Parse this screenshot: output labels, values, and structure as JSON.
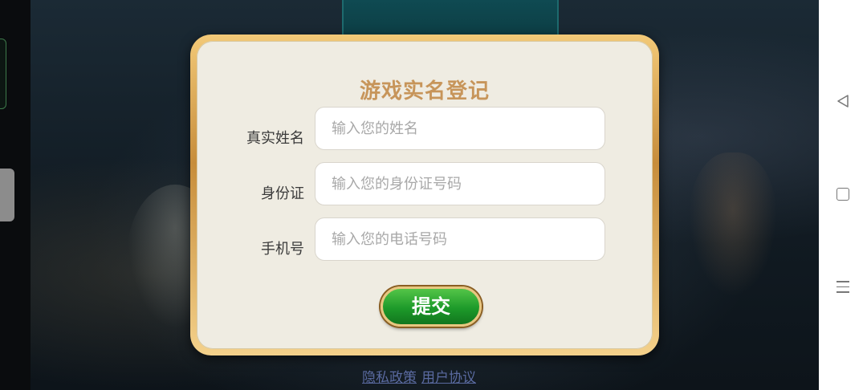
{
  "form": {
    "title": "游戏实名登记",
    "fields": [
      {
        "label": "真实姓名",
        "placeholder": "输入您的姓名"
      },
      {
        "label": "身份证",
        "placeholder": "输入您的身份证号码"
      },
      {
        "label": "手机号",
        "placeholder": "输入您的电话号码"
      }
    ],
    "submit_label": "提交"
  },
  "footer": {
    "privacy_label": "隐私政策",
    "agreement_label": "用户协议"
  },
  "system_nav": {
    "icons": [
      "back-triangle-icon",
      "home-square-icon",
      "menu-lines-icon"
    ]
  },
  "colors": {
    "title": "#c7955a",
    "submit_green": "#1d9a2a",
    "modal_border_gold": "#e2b566",
    "modal_bg": "#efece2",
    "link": "#5a6aa0"
  }
}
